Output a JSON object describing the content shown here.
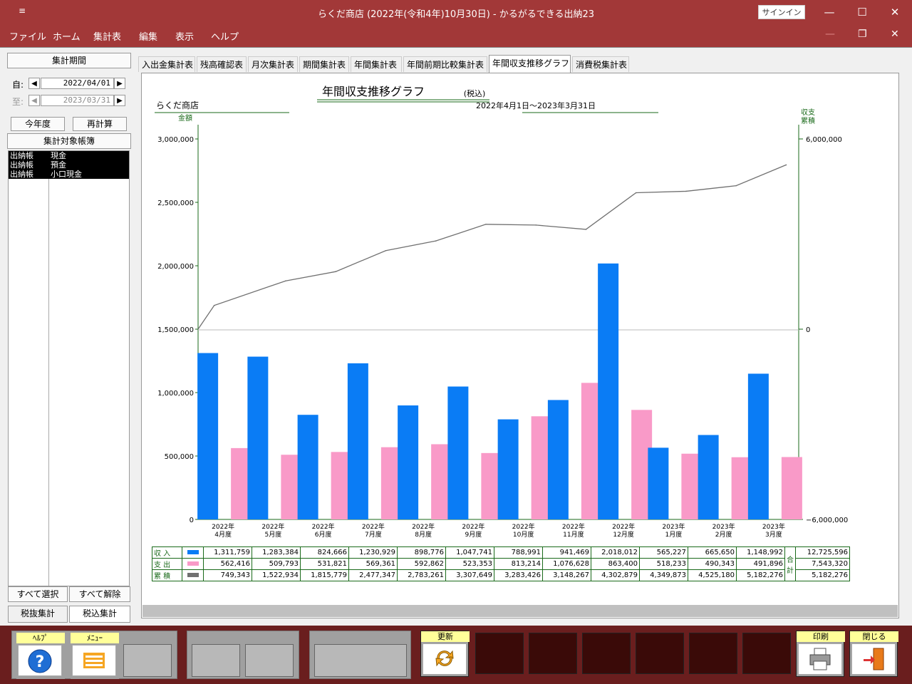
{
  "window": {
    "title": "らくだ商店 (2022年(令和4年)10月30日)  -  かるがるできる出納23",
    "signin": "サインイン",
    "qa": "≡"
  },
  "menu": [
    "ファイル",
    "ホーム",
    "集計表",
    "編集",
    "表示",
    "ヘルプ"
  ],
  "left": {
    "period_btn": "集計期間",
    "from_label": "自:",
    "from_date": "2022/04/01",
    "to_label": "至:",
    "to_date": "2023/03/31",
    "this_year": "今年度",
    "recalc": "再計算",
    "target": "集計対象帳簿",
    "ledgers": [
      {
        "type": "出納帳",
        "name": "現金"
      },
      {
        "type": "出納帳",
        "name": "預金"
      },
      {
        "type": "出納帳",
        "name": "小口現金"
      }
    ],
    "select_all": "すべて選択",
    "deselect_all": "すべて解除",
    "tax_ex": "税抜集計",
    "tax_in": "税込集計"
  },
  "tabs": [
    "入出金集計表",
    "残高確認表",
    "月次集計表",
    "期間集計表",
    "年間集計表",
    "年間前期比較集計表",
    "年間収支推移グラフ",
    "消費税集計表"
  ],
  "report": {
    "title": "年間収支推移グラフ",
    "title_suffix": "(税込)",
    "shop": "らくだ商店",
    "period": "2022年4月1日～2023年3月31日",
    "left_axis": "金額",
    "right_axis_1": "収支",
    "right_axis_2": "累積",
    "total_label_1": "合",
    "total_label_2": "計"
  },
  "chart_data": {
    "type": "bar",
    "categories": [
      "2022年4月度",
      "2022年5月度",
      "2022年6月度",
      "2022年7月度",
      "2022年8月度",
      "2022年9月度",
      "2022年10月度",
      "2022年11月度",
      "2022年12月度",
      "2023年1月度",
      "2023年2月度",
      "2023年3月度"
    ],
    "cat_line1": [
      "2022年",
      "2022年",
      "2022年",
      "2022年",
      "2022年",
      "2022年",
      "2022年",
      "2022年",
      "2022年",
      "2023年",
      "2023年",
      "2023年"
    ],
    "cat_line2": [
      "4月度",
      "5月度",
      "6月度",
      "7月度",
      "8月度",
      "9月度",
      "10月度",
      "11月度",
      "12月度",
      "1月度",
      "2月度",
      "3月度"
    ],
    "yticks": [
      "3,000,000",
      "2,500,000",
      "2,000,000",
      "1,500,000",
      "1,000,000",
      "500,000",
      "0"
    ],
    "y2ticks": [
      "6,000,000",
      "0",
      "−6,000,000"
    ],
    "ylim": [
      0,
      3000000
    ],
    "y2lim": [
      -6000000,
      6000000
    ],
    "series": [
      {
        "name": "収 入",
        "color": "#0a7cf5",
        "values": [
          1311759,
          1283384,
          824666,
          1230929,
          898776,
          1047741,
          788991,
          941469,
          2018012,
          565227,
          665650,
          1148992
        ],
        "labels": [
          "1,311,759",
          "1,283,384",
          "824,666",
          "1,230,929",
          "898,776",
          "1,047,741",
          "788,991",
          "941,469",
          "2,018,012",
          "565,227",
          "665,650",
          "1,148,992"
        ],
        "total": "12,725,596"
      },
      {
        "name": "支 出",
        "color": "#f99ac8",
        "values": [
          562416,
          509793,
          531821,
          569361,
          592862,
          523353,
          813214,
          1076628,
          863400,
          518233,
          490343,
          491896
        ],
        "labels": [
          "562,416",
          "509,793",
          "531,821",
          "569,361",
          "592,862",
          "523,353",
          "813,214",
          "1,076,628",
          "863,400",
          "518,233",
          "490,343",
          "491,896"
        ],
        "total": "7,543,320"
      },
      {
        "name": "累 積",
        "color": "#707070",
        "values": [
          749343,
          1522934,
          1815779,
          2477347,
          2783261,
          3307649,
          3283426,
          3148267,
          4302879,
          4349873,
          4525180,
          5182276
        ],
        "labels": [
          "749,343",
          "1,522,934",
          "1,815,779",
          "2,477,347",
          "2,783,261",
          "3,307,649",
          "3,283,426",
          "3,148,267",
          "4,302,879",
          "4,349,873",
          "4,525,180",
          "5,182,276"
        ],
        "total": "5,182,276"
      }
    ]
  },
  "toolbar": {
    "help": "ﾍﾙﾌﾟ",
    "menu": "ﾒﾆｭｰ",
    "refresh": "更新",
    "print": "印刷",
    "close": "閉じる"
  }
}
